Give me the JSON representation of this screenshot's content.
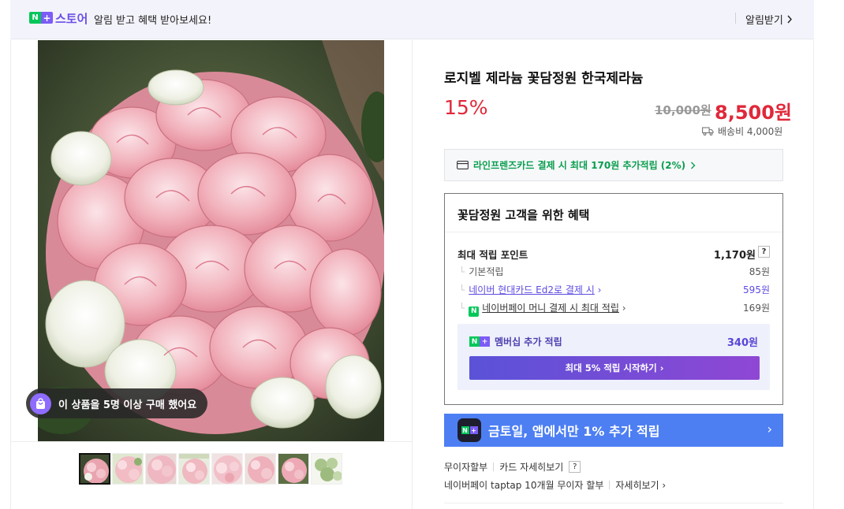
{
  "topbar": {
    "badge_n": "N",
    "badge_plus": "+",
    "store_label": "스토어",
    "promo_text": "알림 받고 혜택 받아보세요!",
    "alarm_label": "알림받기"
  },
  "gallery": {
    "buyer_badge": "이 상품을 5명 이상 구매 했어요",
    "thumbnails": 8
  },
  "product": {
    "title": "로지벨 제라늄 꽃담정원 한국제라늄",
    "discount": "15%",
    "original_price": "10,000원",
    "sale_price": "8,500원",
    "shipping": "배송비 4,000원"
  },
  "card_promo": "라인프렌즈카드 결제 시 최대 170원 추가적립 (2%)",
  "benefits": {
    "title": "꽃담정원 고객을 위한 혜택",
    "max_points_label": "최대 적립 포인트",
    "max_points_value": "1,170원",
    "help": "?",
    "rows": [
      {
        "label": "기본적립",
        "value": "85원"
      },
      {
        "label": "네이버 현대카드 Ed2로 결제 시",
        "value": "595원"
      },
      {
        "label": "네이버페이 머니 결제 시 최대 적립",
        "value": "169원"
      }
    ],
    "membership_label": "멤버십 추가 적립",
    "membership_value": "340원",
    "membership_button": "최대 5% 적립 시작하기"
  },
  "app_banner": "금토일, 앱에서만 1% 추가 적립",
  "installment": {
    "no_interest": "무이자할부",
    "card_detail": "카드 자세히보기",
    "taptap": "네이버페이 taptap 10개월 무이자 할부",
    "detail": "자세히보기"
  },
  "colors": {
    "accent_red": "#e0283a",
    "naver_green": "#03c75a",
    "brand_purple": "#6b4fe8",
    "banner_blue": "#4d7ff3"
  }
}
